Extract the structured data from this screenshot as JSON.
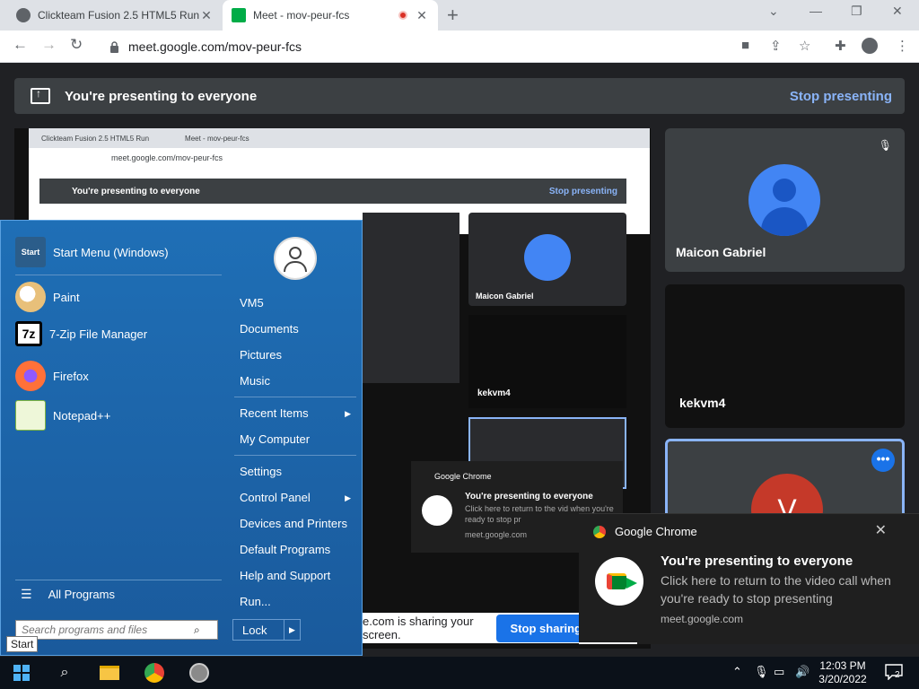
{
  "browser": {
    "tabs": [
      {
        "title": "Clickteam Fusion 2.5 HTML5 Run",
        "active": false
      },
      {
        "title": "Meet - mov-peur-fcs",
        "active": true
      }
    ],
    "url": "meet.google.com/mov-peur-fcs"
  },
  "meet": {
    "banner_text": "You're presenting to everyone",
    "stop_presenting": "Stop presenting",
    "participant_name": "Maicon Gabriel",
    "second_tile_label": "kekvm4",
    "tile_initial": "V",
    "share_bar_text": "e.com is sharing your screen.",
    "stop_sharing": "Stop sharing"
  },
  "mini": {
    "tab1": "Clickteam Fusion 2.5 HTML5 Run",
    "tab2": "Meet - mov-peur-fcs",
    "url": "meet.google.com/mov-peur-fcs",
    "banner": "You're presenting to everyone",
    "stop": "Stop presenting",
    "name": "Maicon Gabriel",
    "label": "kekvm4"
  },
  "notification": {
    "app": "Google Chrome",
    "title": "You're presenting to everyone",
    "body": "Click here to return to the video call when you're ready to stop presenting",
    "source": "meet.google.com"
  },
  "ghost_notification": {
    "app": "Google Chrome",
    "title": "You're presenting to everyone",
    "body": "Click here to return to the vid when you're ready to stop pr",
    "source": "meet.google.com"
  },
  "start_menu": {
    "pinned": [
      {
        "label": "Start Menu (Windows)",
        "icon": "start-menu-icon"
      },
      {
        "label": "Paint",
        "icon": "paint-icon"
      },
      {
        "label": "7-Zip File Manager",
        "icon": "7zip-icon"
      },
      {
        "label": "Firefox",
        "icon": "firefox-icon"
      },
      {
        "label": "Notepad++",
        "icon": "notepad-plus-plus-icon"
      }
    ],
    "all_programs": "All Programs",
    "search_placeholder": "Search programs and files",
    "right": {
      "user": "VM5",
      "documents": "Documents",
      "pictures": "Pictures",
      "music": "Music",
      "recent_items": "Recent Items",
      "my_computer": "My Computer",
      "settings": "Settings",
      "control_panel": "Control Panel",
      "devices_printers": "Devices and Printers",
      "default_programs": "Default Programs",
      "help_support": "Help and Support",
      "run": "Run..."
    },
    "lock": "Lock",
    "start_tooltip": "Start",
    "start_icon_text": "Start"
  },
  "taskbar": {
    "time": "12:03 PM",
    "date": "3/20/2022",
    "notification_count": "2",
    "seven_zip_glyph": "7z"
  }
}
